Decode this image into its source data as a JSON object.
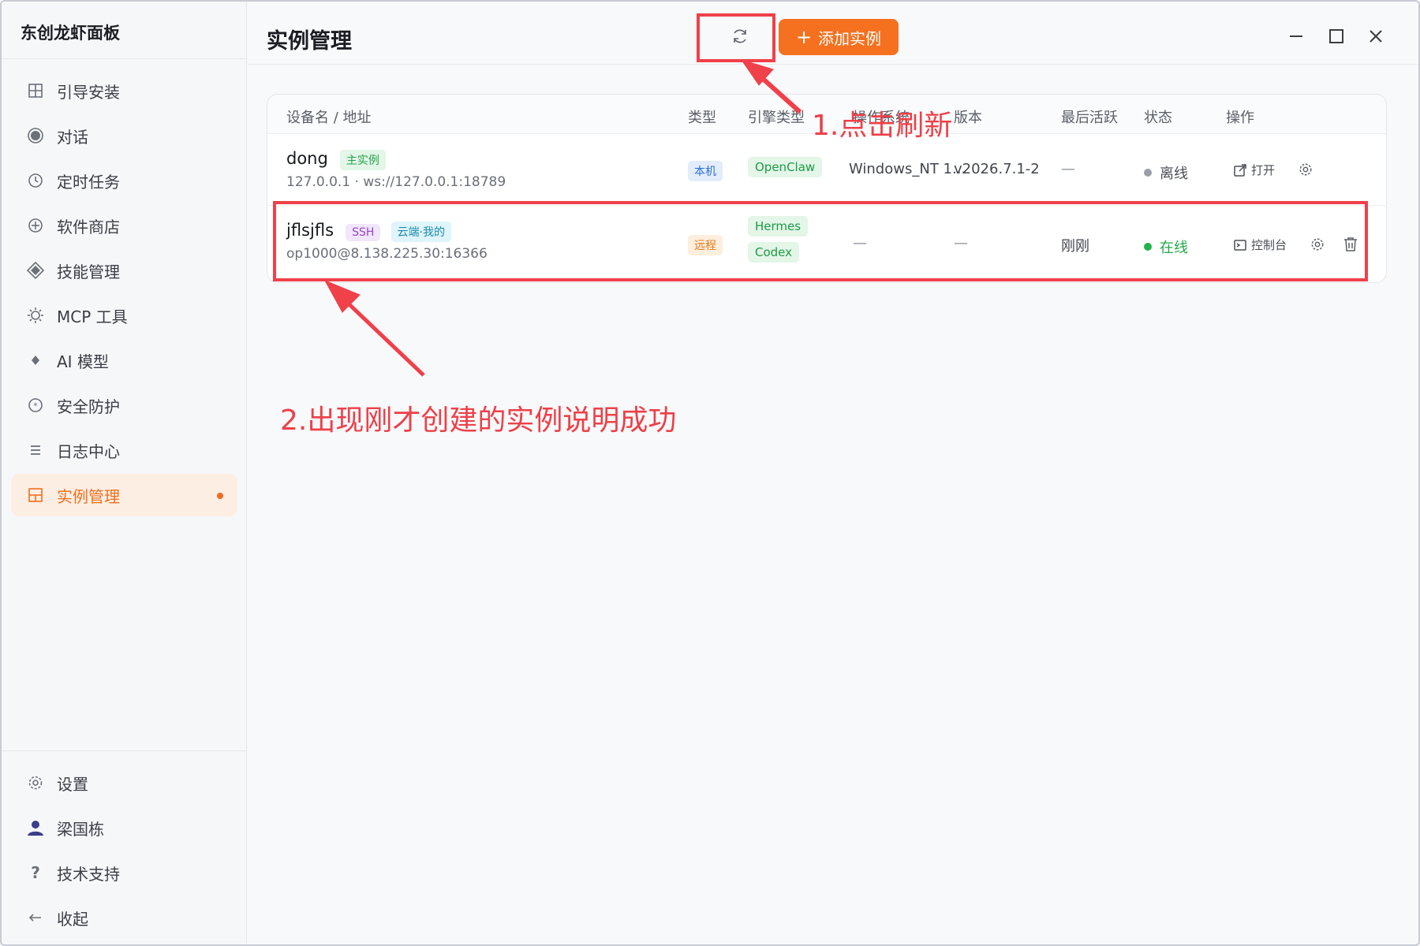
{
  "app": {
    "brand": "东创龙虾面板"
  },
  "sidebar": {
    "items": [
      {
        "label": "引导安装",
        "icon": "grid-icon"
      },
      {
        "label": "对话",
        "icon": "chat-icon"
      },
      {
        "label": "定时任务",
        "icon": "clock-icon"
      },
      {
        "label": "软件商店",
        "icon": "store-icon"
      },
      {
        "label": "技能管理",
        "icon": "diamond-icon"
      },
      {
        "label": "MCP 工具",
        "icon": "sun-icon"
      },
      {
        "label": "AI 模型",
        "icon": "sparkle-icon"
      },
      {
        "label": "安全防护",
        "icon": "shield-icon"
      },
      {
        "label": "日志中心",
        "icon": "list-icon"
      },
      {
        "label": "实例管理",
        "icon": "instance-icon",
        "active": true
      }
    ],
    "bottom": [
      {
        "label": "设置",
        "icon": "gear-icon"
      },
      {
        "label": "梁国栋",
        "icon": "user-icon"
      },
      {
        "label": "技术支持",
        "icon": "question-icon"
      },
      {
        "label": "收起",
        "icon": "arrow-left-icon"
      }
    ]
  },
  "header": {
    "title": "实例管理",
    "add_label": "添加实例"
  },
  "table": {
    "columns": [
      "设备名 / 地址",
      "类型",
      "引擎类型",
      "操作系统",
      "版本",
      "最后活跃",
      "状态",
      "操作"
    ],
    "rows": [
      {
        "name": "dong",
        "badges": [
          "主实例"
        ],
        "address": "127.0.0.1 · ws://127.0.0.1:18789",
        "type": "本机",
        "engines": [
          "OpenClaw"
        ],
        "os": "Windows_NT 1...",
        "version": "v2026.7.1-2",
        "last_active": "—",
        "status": "离线",
        "actions": [
          "打开"
        ]
      },
      {
        "name": "jflsjfls",
        "badges": [
          "SSH",
          "云端·我的"
        ],
        "address": "op1000@8.138.225.30:16366",
        "type": "远程",
        "engines": [
          "Hermes",
          "Codex"
        ],
        "os": "—",
        "version": "—",
        "last_active": "刚刚",
        "status": "在线",
        "actions": [
          "控制台"
        ]
      }
    ]
  },
  "annotations": {
    "step1": "1.点击刷新",
    "step2": "2.出现刚才创建的实例说明成功"
  },
  "colors": {
    "accent": "#f5711f",
    "online": "#22b34a",
    "offline": "#9aa0a8",
    "annotation": "#f0404a"
  }
}
